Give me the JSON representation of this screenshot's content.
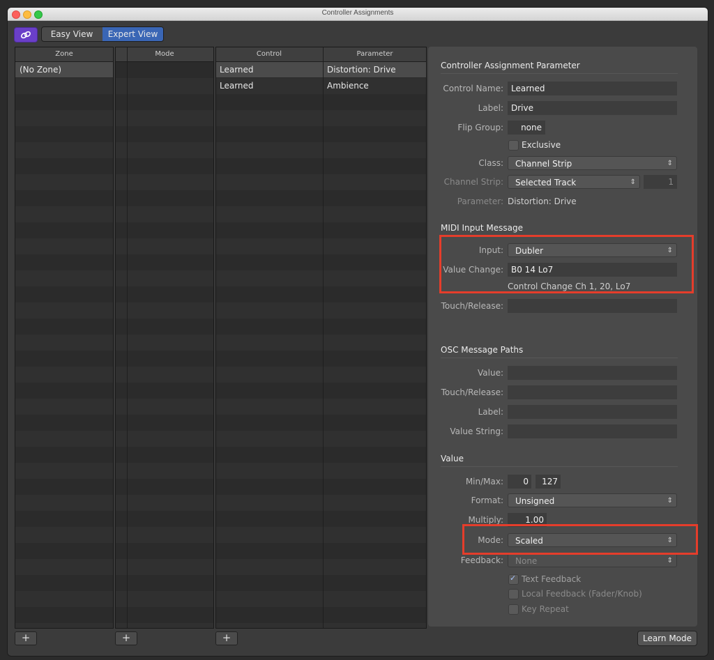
{
  "window": {
    "title": "Controller Assignments"
  },
  "toolbar": {
    "easy_view": "Easy View",
    "expert_view": "Expert View"
  },
  "zone": {
    "header": "Zone",
    "items": [
      "(No Zone)"
    ]
  },
  "mode_list": {
    "header": "Mode"
  },
  "control_list": {
    "headers": [
      "Control",
      "Parameter"
    ],
    "rows": [
      {
        "control": "Learned",
        "parameter": "Distortion: Drive"
      },
      {
        "control": "Learned",
        "parameter": "Ambience"
      }
    ]
  },
  "add_button": "+",
  "params": {
    "section_title": "Controller Assignment Parameter",
    "control_name_label": "Control Name:",
    "control_name_value": "Learned",
    "label_label": "Label:",
    "label_value": "Drive",
    "flip_group_label": "Flip Group:",
    "flip_group_value": "none",
    "exclusive_label": "Exclusive",
    "class_label": "Class:",
    "class_value": "Channel Strip",
    "channel_strip_label": "Channel Strip:",
    "channel_strip_value": "Selected Track",
    "channel_strip_number": "1",
    "parameter_label": "Parameter:",
    "parameter_value": "Distortion: Drive"
  },
  "midi": {
    "section_title": "MIDI Input Message",
    "input_label": "Input:",
    "input_value": "Dubler",
    "value_change_label": "Value Change:",
    "value_change_value": "B0 14 Lo7",
    "value_change_desc": "Control Change Ch 1, 20, Lo7",
    "touch_release_label": "Touch/Release:"
  },
  "osc": {
    "section_title": "OSC Message Paths",
    "value_label": "Value:",
    "touch_release_label": "Touch/Release:",
    "label_label": "Label:",
    "value_string_label": "Value String:"
  },
  "value": {
    "section_title": "Value",
    "minmax_label": "Min/Max:",
    "min": "0",
    "max": "127",
    "format_label": "Format:",
    "format_value": "Unsigned",
    "multiply_label": "Multiply:",
    "multiply_value": "1.00",
    "mode_label": "Mode:",
    "mode_value": "Scaled",
    "feedback_label": "Feedback:",
    "feedback_value": "None",
    "text_feedback": "Text Feedback",
    "local_feedback": "Local Feedback (Fader/Knob)",
    "key_repeat": "Key Repeat"
  },
  "learn_mode": "Learn Mode",
  "colors": {
    "accent": "#3a66b5",
    "link_button": "#6a3fc8",
    "highlight": "#e53d2b"
  }
}
